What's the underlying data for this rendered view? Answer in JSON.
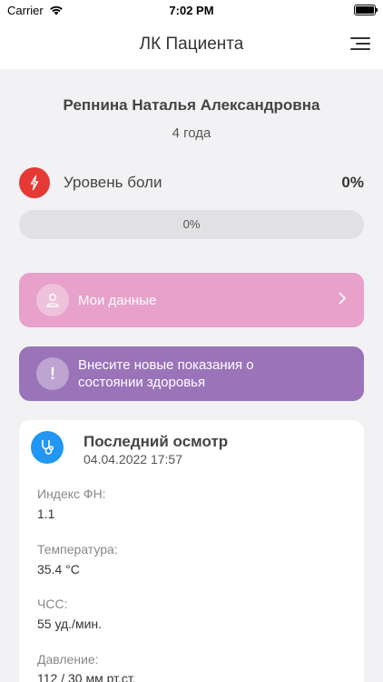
{
  "status_bar": {
    "carrier": "Carrier",
    "time": "7:02 PM"
  },
  "nav": {
    "title": "ЛК Пациента"
  },
  "patient": {
    "name": "Репнина Наталья Александровна",
    "age": "4 года"
  },
  "pain": {
    "label": "Уровень боли",
    "value": "0%",
    "progress_text": "0%",
    "progress_fraction": 0
  },
  "actions": {
    "my_data_label": "Мои данные",
    "new_readings_label": "Внесите новые показания о состоянии здоровья"
  },
  "exam": {
    "title": "Последний осмотр",
    "date": "04.04.2022 17:57",
    "fields": [
      {
        "label": "Индекс ФН:",
        "value": "1.1"
      },
      {
        "label": "Температура:",
        "value": "35.4 °C"
      },
      {
        "label": "ЧСС:",
        "value": "55 уд./мин."
      },
      {
        "label": "Давление:",
        "value": "112 / 30 мм рт.ст."
      }
    ]
  },
  "colors": {
    "pain_icon": "#e53935",
    "my_data_card": "#e7a1ca",
    "new_readings_card": "#9a73b9",
    "exam_icon": "#2196f3"
  },
  "icons": {
    "pain": "lightning-icon",
    "my_data": "user-icon",
    "new_readings": "exclamation-icon",
    "exam": "stethoscope-icon",
    "menu": "menu-icon",
    "chevron": "chevron-right-icon"
  }
}
